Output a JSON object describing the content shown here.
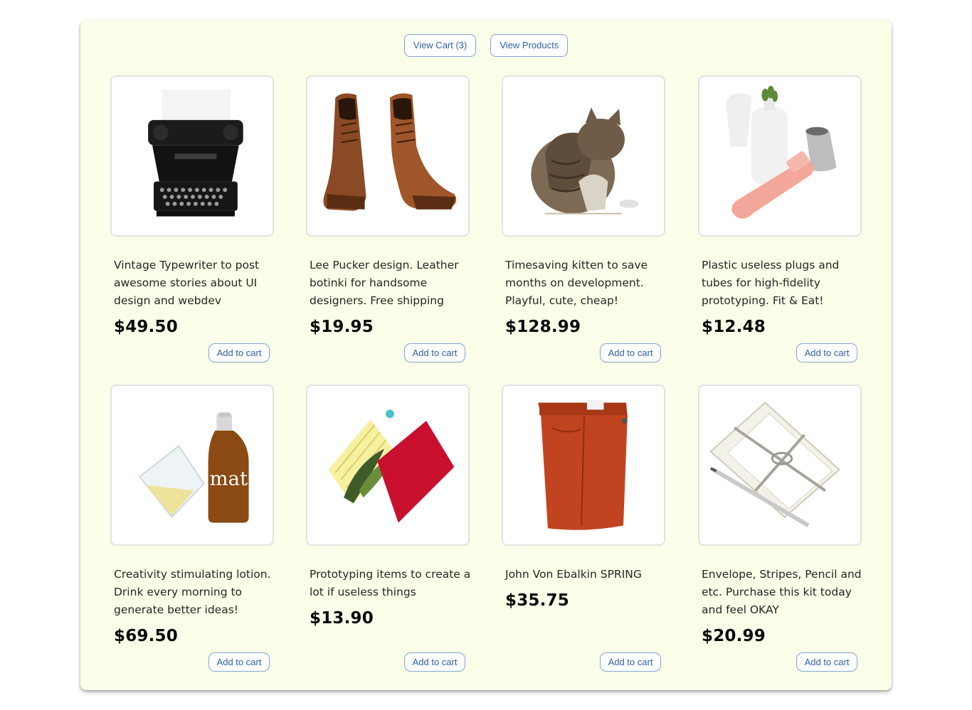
{
  "nav": {
    "view_cart_label": "View Cart (3)",
    "view_products_label": "View Products"
  },
  "products": [
    {
      "image": "typewriter",
      "description": "Vintage Typewriter to post awesome stories about UI design and webdev",
      "price": "$49.50",
      "button_label": "Add to cart"
    },
    {
      "image": "leather boots",
      "description": "Lee Pucker design. Leather botinki for handsome designers. Free shipping",
      "price": "$19.95",
      "button_label": "Add to cart"
    },
    {
      "image": "tabby kitten",
      "description": "Timesaving kitten to save months on development. Playful, cute, cheap!",
      "price": "$128.99",
      "button_label": "Add to cart"
    },
    {
      "image": "vases and plug",
      "description": "Plastic useless plugs and tubes for high-fidelity prototyping. Fit & Eat!",
      "price": "$12.48",
      "button_label": "Add to cart"
    },
    {
      "image": "glass and mate bottle",
      "description": "Creativity stimulating lotion. Drink every morning to generate better ideas!",
      "price": "$69.50",
      "button_label": "Add to cart"
    },
    {
      "image": "notebook and plant",
      "description": "Prototyping items to create a lot if useless things",
      "price": "$13.90",
      "button_label": "Add to cart"
    },
    {
      "image": "folded red pants",
      "description": "John Von Ebalkin SPRING",
      "price": "$35.75",
      "button_label": "Add to cart"
    },
    {
      "image": "envelope and pencil",
      "description": "Envelope, Stripes, Pencil and etc. Purchase this kit today and feel OKAY",
      "price": "$20.99",
      "button_label": "Add to cart"
    }
  ],
  "colors": {
    "panel_background": "#fbfee8",
    "button_border": "#7fa6d1",
    "button_text": "#2e5fa7"
  }
}
